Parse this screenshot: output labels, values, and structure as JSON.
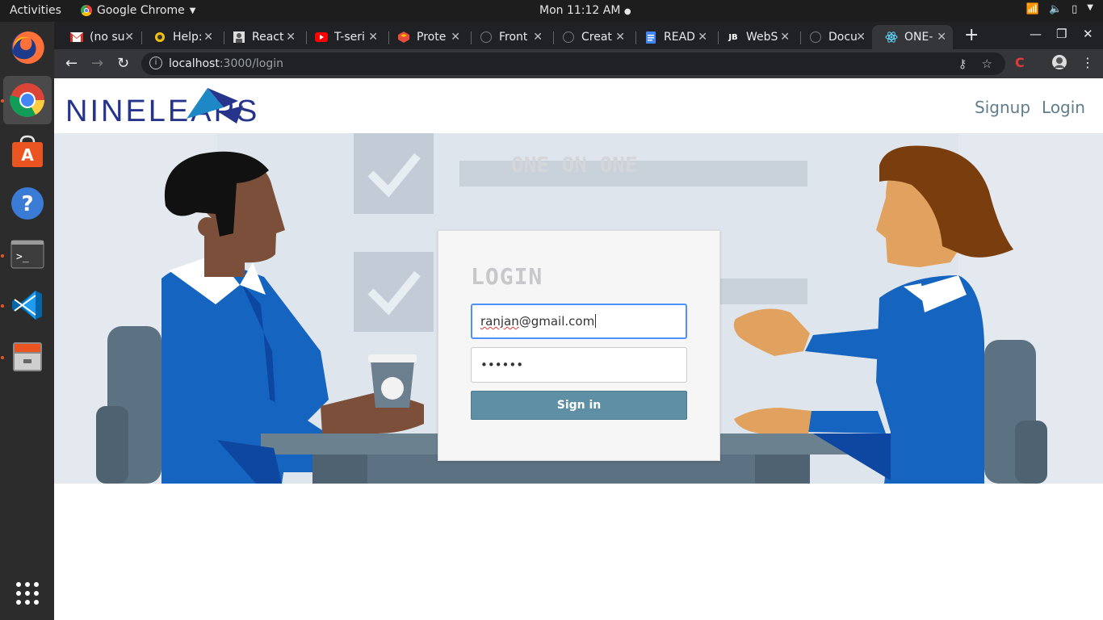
{
  "system": {
    "activities": "Activities",
    "app_name": "Google Chrome",
    "clock": "Mon 11:12 AM"
  },
  "dock": {
    "items": [
      "firefox-icon",
      "chrome-icon",
      "software-center-icon",
      "help-icon",
      "terminal-icon",
      "vscode-icon",
      "files-icon",
      "app-grid-icon"
    ]
  },
  "browser": {
    "tabs": [
      {
        "title": "(no su",
        "icon": "gmail-icon"
      },
      {
        "title": "Help:",
        "icon": "help-page-icon"
      },
      {
        "title": "React",
        "icon": "react-page-icon"
      },
      {
        "title": "T-seri",
        "icon": "youtube-icon"
      },
      {
        "title": "Prote",
        "icon": "proto-icon"
      },
      {
        "title": "Front",
        "icon": "github-icon"
      },
      {
        "title": "Creat",
        "icon": "github-icon"
      },
      {
        "title": "READ",
        "icon": "docs-icon"
      },
      {
        "title": "WebS",
        "icon": "jetbrains-icon"
      },
      {
        "title": "Docu",
        "icon": "github-icon"
      },
      {
        "title": "ONE-",
        "icon": "react-icon",
        "active": true
      }
    ],
    "url_host": "localhost",
    "url_path": ":3000/login"
  },
  "site": {
    "logo_text": "NINELEAPS",
    "nav": {
      "signup": "Signup",
      "login": "Login"
    },
    "hero_text": "ONE ON ONE"
  },
  "login": {
    "title": "LOGIN",
    "email_value_spell": "ranjan",
    "email_value_rest": "@gmail.com",
    "password_value": "••••••",
    "submit_label": "Sign in"
  }
}
